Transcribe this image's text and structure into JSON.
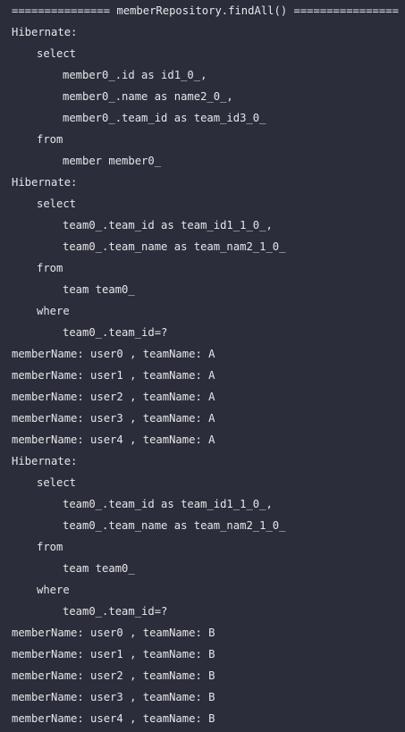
{
  "console": {
    "lines": [
      {
        "text": "=============== memberRepository.findAll() ================",
        "indent": 0
      },
      {
        "text": "Hibernate:",
        "indent": 0
      },
      {
        "text": "select",
        "indent": 1
      },
      {
        "text": "member0_.id as id1_0_,",
        "indent": 2
      },
      {
        "text": "member0_.name as name2_0_,",
        "indent": 2
      },
      {
        "text": "member0_.team_id as team_id3_0_",
        "indent": 2
      },
      {
        "text": "from",
        "indent": 1
      },
      {
        "text": "member member0_",
        "indent": 2
      },
      {
        "text": "Hibernate:",
        "indent": 0
      },
      {
        "text": "select",
        "indent": 1
      },
      {
        "text": "team0_.team_id as team_id1_1_0_,",
        "indent": 2
      },
      {
        "text": "team0_.team_name as team_nam2_1_0_",
        "indent": 2
      },
      {
        "text": "from",
        "indent": 1
      },
      {
        "text": "team team0_",
        "indent": 2
      },
      {
        "text": "where",
        "indent": 1
      },
      {
        "text": "team0_.team_id=?",
        "indent": 2
      },
      {
        "text": "memberName: user0 , teamName: A",
        "indent": 0
      },
      {
        "text": "memberName: user1 , teamName: A",
        "indent": 0
      },
      {
        "text": "memberName: user2 , teamName: A",
        "indent": 0
      },
      {
        "text": "memberName: user3 , teamName: A",
        "indent": 0
      },
      {
        "text": "memberName: user4 , teamName: A",
        "indent": 0
      },
      {
        "text": "Hibernate:",
        "indent": 0
      },
      {
        "text": "select",
        "indent": 1
      },
      {
        "text": "team0_.team_id as team_id1_1_0_,",
        "indent": 2
      },
      {
        "text": "team0_.team_name as team_nam2_1_0_",
        "indent": 2
      },
      {
        "text": "from",
        "indent": 1
      },
      {
        "text": "team team0_",
        "indent": 2
      },
      {
        "text": "where",
        "indent": 1
      },
      {
        "text": "team0_.team_id=?",
        "indent": 2
      },
      {
        "text": "memberName: user0 , teamName: B",
        "indent": 0
      },
      {
        "text": "memberName: user1 , teamName: B",
        "indent": 0
      },
      {
        "text": "memberName: user2 , teamName: B",
        "indent": 0
      },
      {
        "text": "memberName: user3 , teamName: B",
        "indent": 0
      },
      {
        "text": "memberName: user4 , teamName: B",
        "indent": 0
      }
    ]
  }
}
